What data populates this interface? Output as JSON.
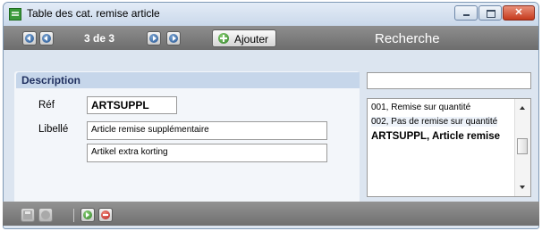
{
  "window": {
    "title": "Table des cat. remise article"
  },
  "toolbar": {
    "counter": "3 de 3",
    "add_label": "Ajouter"
  },
  "search": {
    "title": "Recherche",
    "value": ""
  },
  "description": {
    "header": "Description",
    "ref_label": "Réf",
    "ref_value": "ARTSUPPL",
    "libelle_label": "Libellé",
    "libelle_value": "Article remise supplémentaire",
    "libelle2_value": "Artikel extra korting"
  },
  "results": [
    "001, Remise sur quantité",
    "002, Pas de remise sur quantité",
    "ARTSUPPL, Article remise"
  ],
  "colors": {
    "toolbar": "#7e7e7e",
    "title_bar": "#dce5f0",
    "section_header": "#c6d6ea"
  }
}
